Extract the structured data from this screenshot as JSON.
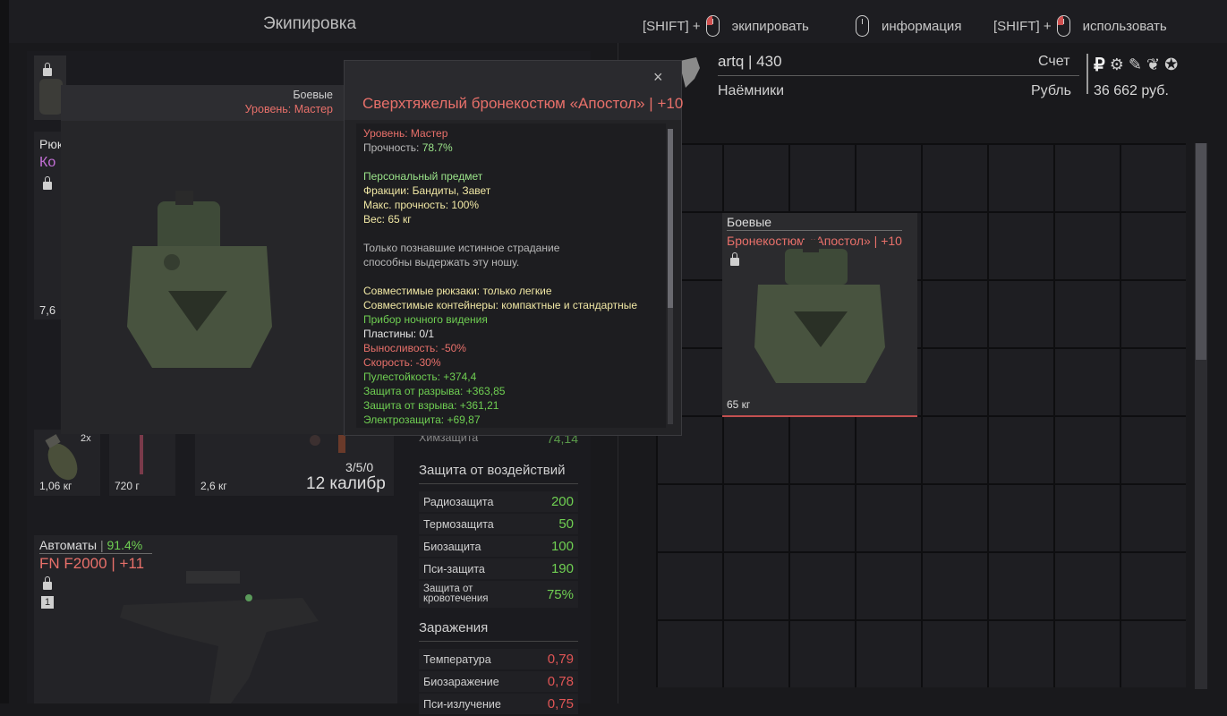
{
  "header": {
    "title": "Экипировка",
    "hints": [
      {
        "prefix": "[SHIFT] +",
        "label": "экипировать"
      },
      {
        "prefix": "",
        "label": "информация"
      },
      {
        "prefix": "[SHIFT] +",
        "label": "использовать"
      }
    ]
  },
  "left": {
    "backpack_label": "Рюк",
    "backpack_name": "Ко",
    "backpack_weight": "7,6",
    "small_slots": [
      {
        "count": "2x",
        "weight": "1,06 кг"
      },
      {
        "weight": "720 г"
      },
      {
        "weight": "2,6 кг",
        "ammo": "3/5/0",
        "caliber": "12 калибр"
      }
    ],
    "weapon": {
      "category": "Автоматы",
      "condition": "91.4%",
      "name": "FN F2000",
      "upgrade": "+11",
      "slot_number": "1"
    },
    "stats_partial": {
      "label": "Химзащита",
      "value": "74,14"
    }
  },
  "stats": {
    "impact_title": "Защита от воздействий",
    "impact": [
      {
        "label": "Радиозащита",
        "value": "200"
      },
      {
        "label": "Термозащита",
        "value": "50"
      },
      {
        "label": "Биозащита",
        "value": "100"
      },
      {
        "label": "Пси-защита",
        "value": "190"
      },
      {
        "label": "Защита от кровотечения",
        "value": "75%"
      }
    ],
    "infection_title": "Заражения",
    "infection": [
      {
        "label": "Температура",
        "value": "0,79"
      },
      {
        "label": "Биозаражение",
        "value": "0,78"
      },
      {
        "label": "Пси-излучение",
        "value": "0,75"
      }
    ]
  },
  "tooltip": {
    "category": "Боевые",
    "level": "Уровень: Мастер",
    "close": "×",
    "title": "Сверхтяжелый бронекостюм «Апостол» | +10",
    "lines": {
      "level": "Уровень: Мастер",
      "durability_label": "Прочность: ",
      "durability_value": "78.7%",
      "personal": "Персональный предмет",
      "factions": "Фракции: Бандиты, Завет",
      "max_durability": "Макс. прочность: 100%",
      "weight": "Вес: 65 кг",
      "desc1": "Только познавшие истинное страдание",
      "desc2": "способны выдержать эту ношу.",
      "compat_backpacks": "Совместимые рюкзаки: только легкие",
      "compat_containers": "Совместимые контейнеры: компактные и стандартные",
      "night_vision": "Прибор ночного видения",
      "plates": "Пластины: 0/1",
      "stamina": "Выносливость: -50%",
      "speed": "Скорость: -30%",
      "bullet": "Пулестойкость: +374,4",
      "tear": "Защита от разрыва: +363,85",
      "blast": "Защита от взрыва: +361,21",
      "electro": "Электрозащита: +69,87"
    }
  },
  "account": {
    "player_name": "artq",
    "player_level": "430",
    "faction": "Наёмники",
    "label": "Счет",
    "currency": "Рубль",
    "money": "36 662 руб."
  },
  "inventory_item": {
    "category": "Боевые",
    "name": "Бронекостюм «Апостол» | +10",
    "weight": "65 кг"
  },
  "colors": {
    "accent_red": "#e8706a",
    "green": "#6fcf52",
    "bg": "#19191c"
  }
}
